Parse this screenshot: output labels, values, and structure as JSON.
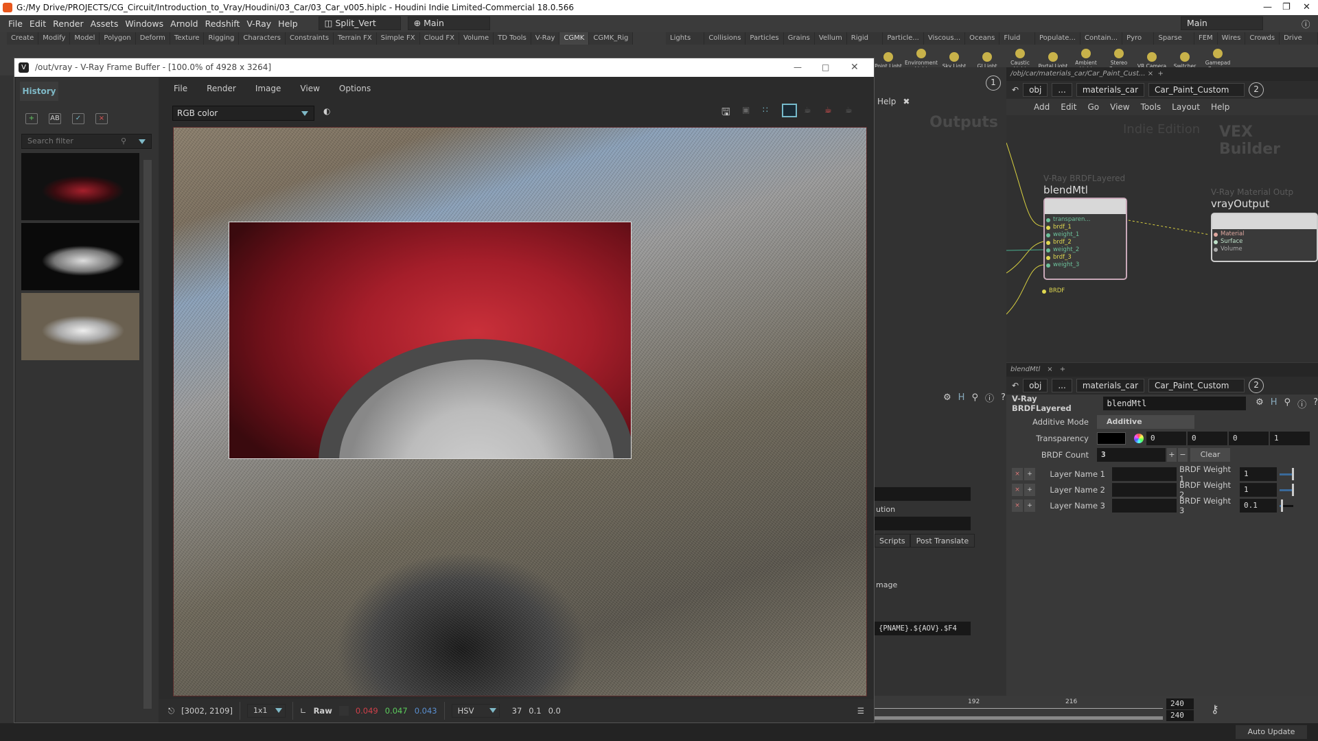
{
  "window": {
    "title": "G:/My Drive/PROJECTS/CG_Circuit/Introduction_to_Vray/Houdini/03_Car/03_Car_v005.hiplc - Houdini Indie Limited-Commercial 18.0.566"
  },
  "menu": [
    "File",
    "Edit",
    "Render",
    "Assets",
    "Windows",
    "Arnold",
    "Redshift",
    "V-Ray",
    "Help"
  ],
  "desktop_layout": "Split_Vert",
  "desktop": "Main",
  "top_right_desktop": "Main",
  "shelf_tabs_left": [
    "Create",
    "Modify",
    "Model",
    "Polygon",
    "Deform",
    "Texture",
    "Rigging",
    "Characters",
    "Constraints",
    "Terrain FX",
    "Simple FX",
    "Cloud FX",
    "Volume",
    "TD Tools",
    "V-Ray",
    "CGMK",
    "CGMK_Rig"
  ],
  "shelf_tabs_left_active": "CGMK",
  "shelf_tabs_right": [
    "Lights a...",
    "Collisions",
    "Particles",
    "Grains",
    "Vellum",
    "Rigid B...",
    "Particle...",
    "Viscous...",
    "Oceans",
    "Fluid C...",
    "Populate...",
    "Contain...",
    "Pyro FX",
    "Sparse P...",
    "FEM",
    "Wires",
    "Crowds",
    "Drive Si..."
  ],
  "shelf_tools": [
    "Point Light",
    "Environment Light",
    "Sky Light",
    "GI Light",
    "Caustic Light",
    "Portal Light",
    "Ambient Light",
    "Stereo Camera",
    "VR Camera",
    "Switcher",
    "Gamepad Camera"
  ],
  "vfb": {
    "title": "/out/vray - V-Ray Frame Buffer - [100.0% of 4928 x 3264]",
    "history_tab": "History",
    "search_placeholder": "Search filter",
    "menu": [
      "File",
      "Render",
      "Image",
      "View",
      "Options"
    ],
    "channel": "RGB color",
    "coords": "[3002, 2109]",
    "sample": "1x1",
    "raw_label": "Raw",
    "r": "0.049",
    "g": "0.047",
    "b": "0.043",
    "colorspace": "HSV",
    "h": "37",
    "s": "0.1",
    "v": "0.0",
    "colors": {
      "r": "#d0404a",
      "g": "#5ccc5c",
      "b": "#5a8fd0"
    }
  },
  "network": {
    "tab": "/obj/car/materials_car/Car_Paint_Cust...",
    "path": [
      "obj",
      "...",
      "materials_car",
      "Car_Paint_Custom"
    ],
    "pane_number": "2",
    "left_pane_number": "1",
    "menu": [
      "Add",
      "Edit",
      "Go",
      "View",
      "Tools",
      "Layout",
      "Help"
    ],
    "left_help": "Help",
    "left_watermark": "Outputs",
    "edition": "Indie Edition",
    "context": "VEX Builder",
    "nodes": [
      {
        "type": "V-Ray BRDFLayered",
        "name": "blendMtl",
        "inputs": [
          "transparen...",
          "brdf_1",
          "weight_1",
          "brdf_2",
          "weight_2",
          "brdf_3",
          "weight_3"
        ],
        "output": "BRDF"
      },
      {
        "type": "V-Ray Material Outp",
        "name": "vrayOutput",
        "inputs": [
          "Material",
          "Surface",
          "Volume"
        ]
      }
    ]
  },
  "params": {
    "tab": "blendMtl",
    "path": [
      "obj",
      "...",
      "materials_car",
      "Car_Paint_Custom"
    ],
    "pane_number": "2",
    "node_type": "V-Ray BRDFLayered",
    "node_name": "blendMtl",
    "additive_mode_label": "Additive Mode",
    "additive_mode": "Additive",
    "transparency_label": "Transparency",
    "transparency": [
      "0",
      "0",
      "0",
      "1"
    ],
    "brdf_count_label": "BRDF Count",
    "brdf_count": "3",
    "clear": "Clear",
    "layers": [
      {
        "name_label": "Layer Name 1",
        "weight_label": "BRDF Weight 1",
        "weight": "1",
        "slider": 1
      },
      {
        "name_label": "Layer Name 2",
        "weight_label": "BRDF Weight 2",
        "weight": "1",
        "slider": 1
      },
      {
        "name_label": "Layer Name 3",
        "weight_label": "BRDF Weight 3",
        "weight": "0.1",
        "slider": 0.1
      }
    ]
  },
  "left_params": {
    "label_ution": "ution",
    "tabs": [
      "Scripts",
      "Post Translate"
    ],
    "label_mage": "mage",
    "file_field": "{PNAME}.${AOV}.$F4"
  },
  "timeline": {
    "ticks": [
      "192",
      "216"
    ],
    "end1": "240",
    "end2": "240"
  },
  "status": {
    "auto_update": "Auto Update"
  }
}
